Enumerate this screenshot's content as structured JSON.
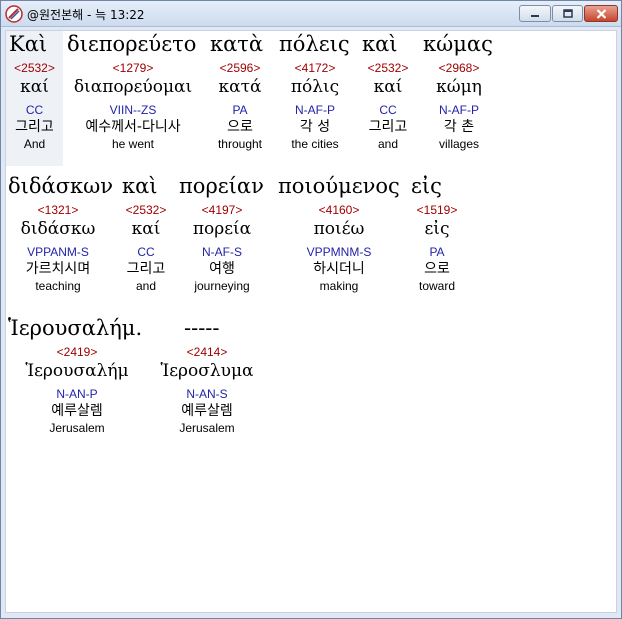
{
  "window": {
    "title": "@원전본해 - 늑 13:22",
    "minimize_label": "minimize",
    "maximize_label": "maximize",
    "close_label": "close"
  },
  "words": [
    {
      "greek": "Καὶ",
      "strong": "<2532>",
      "lemma": "καί",
      "morph": "CC",
      "korean": "그리고",
      "english": "And"
    },
    {
      "greek": "διεπορεύετο",
      "strong": "<1279>",
      "lemma": "διαπορεύομαι",
      "morph": "VIIN--ZS",
      "korean": "예수께서-다니사",
      "english": "he went"
    },
    {
      "greek": "κατὰ",
      "strong": "<2596>",
      "lemma": "κατά",
      "morph": "PA",
      "korean": "으로",
      "english": "throught"
    },
    {
      "greek": "πόλεις",
      "strong": "<4172>",
      "lemma": "πόλις",
      "morph": "N-AF-P",
      "korean": "각 성",
      "english": "the cities"
    },
    {
      "greek": "καὶ",
      "strong": "<2532>",
      "lemma": "καί",
      "morph": "CC",
      "korean": "그리고",
      "english": "and"
    },
    {
      "greek": "κώμας",
      "strong": "<2968>",
      "lemma": "κώμη",
      "morph": "N-AF-P",
      "korean": "각 촌",
      "english": "villages"
    },
    {
      "greek": "διδάσκων",
      "strong": "<1321>",
      "lemma": "διδάσκω",
      "morph": "VPPANM-S",
      "korean": "가르치시며",
      "english": "teaching"
    },
    {
      "greek": "καὶ",
      "strong": "<2532>",
      "lemma": "καί",
      "morph": "CC",
      "korean": "그리고",
      "english": "and"
    },
    {
      "greek": "πορείαν",
      "strong": "<4197>",
      "lemma": "πορεία",
      "morph": "N-AF-S",
      "korean": "여행",
      "english": "journeying"
    },
    {
      "greek": "ποιούμενος",
      "strong": "<4160>",
      "lemma": "ποιέω",
      "morph": "VPPMNM-S",
      "korean": "하시더니",
      "english": "making"
    },
    {
      "greek": "εἰς",
      "strong": "<1519>",
      "lemma": "εἰς",
      "morph": "PA",
      "korean": "으로",
      "english": "toward"
    },
    {
      "greek": "Ἱερουσαλήμ.",
      "strong": "<2419>",
      "lemma": "Ἱερουσαλήμ",
      "morph": "N-AN-P",
      "korean": "예루살렘",
      "english": "Jerusalem"
    },
    {
      "greek": "-----",
      "strong": "<2414>",
      "lemma": "Ἱεροσλυμα",
      "morph": "N-AN-S",
      "korean": "예루살렘",
      "english": "Jerusalem"
    }
  ]
}
